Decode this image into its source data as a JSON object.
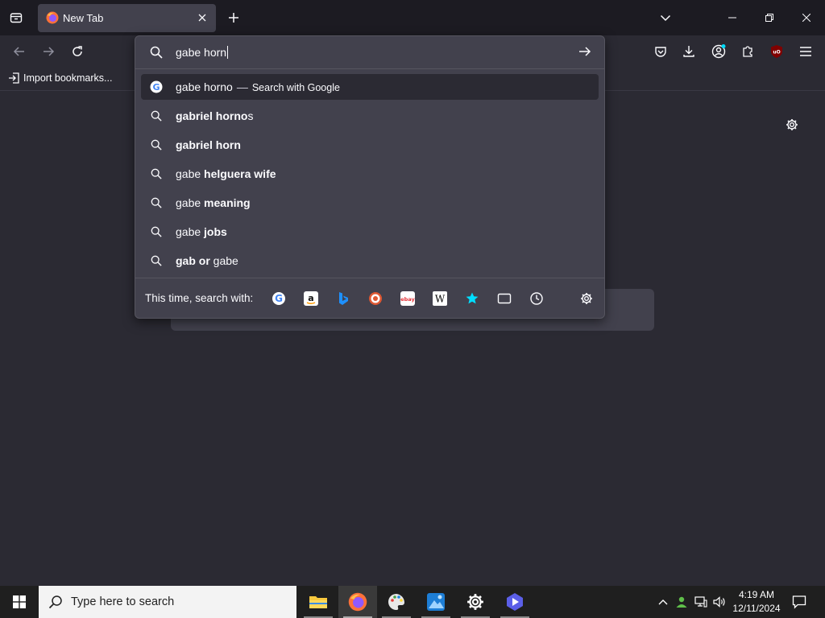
{
  "browser": {
    "tab": {
      "title": "New Tab"
    },
    "bookmarks": {
      "import_label": "Import bookmarks..."
    }
  },
  "urlbar": {
    "input_value": "gabe horn",
    "results": [
      {
        "type": "search",
        "prefix": "gabe horno",
        "bold": "",
        "separator": "—",
        "action": "Search with Google",
        "icon": "google-icon"
      },
      {
        "type": "suggestion",
        "pre": "",
        "bold": "gabriel horno",
        "post": "s",
        "icon": "search-icon"
      },
      {
        "type": "suggestion",
        "pre": "",
        "bold": "gabriel horn",
        "post": "",
        "icon": "search-icon"
      },
      {
        "type": "suggestion",
        "pre": "gabe ",
        "bold": "helguera wife",
        "post": "",
        "icon": "search-icon"
      },
      {
        "type": "suggestion",
        "pre": "gabe ",
        "bold": "meaning",
        "post": "",
        "icon": "search-icon"
      },
      {
        "type": "suggestion",
        "pre": "gabe ",
        "bold": "jobs",
        "post": "",
        "icon": "search-icon"
      },
      {
        "type": "suggestion",
        "pre": "",
        "bold": "gab or",
        "post": " gabe",
        "icon": "search-icon"
      }
    ],
    "oneoff_label": "This time, search with:",
    "engines": [
      "google-icon",
      "amazon-icon",
      "bing-icon",
      "duckduckgo-icon",
      "ebay-icon",
      "wikipedia-icon",
      "bookmarks-star-icon",
      "tabs-icon",
      "history-icon"
    ]
  },
  "taskbar": {
    "search_placeholder": "Type here to search",
    "time": "4:19 AM",
    "date": "12/11/2024"
  },
  "colors": {
    "toolbar_bg": "#2b2a33",
    "tabstrip_bg": "#1c1b22",
    "selected_tab_bg": "#42414d",
    "dropdown_bg": "#42414d",
    "taskbar_bg": "#1f1f1f",
    "accent_blue": "#00ddff"
  }
}
